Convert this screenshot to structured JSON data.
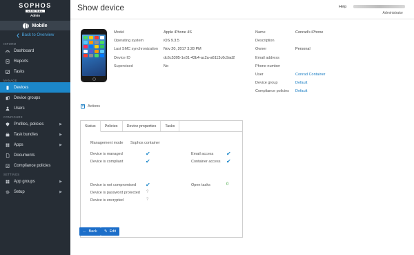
{
  "brand": {
    "name": "SOPHOS",
    "sub": "CENTRAL",
    "role": "Admin"
  },
  "module": {
    "label": "Mobile",
    "back_label": "Back to Overview"
  },
  "sidebar": {
    "sections": [
      {
        "label": "INFORM",
        "items": [
          {
            "label": "Dashboard",
            "icon": "dashboard-icon"
          },
          {
            "label": "Reports",
            "icon": "reports-icon"
          },
          {
            "label": "Tasks",
            "icon": "tasks-icon"
          }
        ]
      },
      {
        "label": "MANAGE",
        "items": [
          {
            "label": "Devices",
            "icon": "devices-icon",
            "active": true
          },
          {
            "label": "Device groups",
            "icon": "device-groups-icon"
          },
          {
            "label": "Users",
            "icon": "users-icon"
          }
        ]
      },
      {
        "label": "CONFIGURE",
        "items": [
          {
            "label": "Profiles, policies",
            "icon": "profiles-icon",
            "expand": true
          },
          {
            "label": "Task bundles",
            "icon": "task-bundles-icon",
            "expand": true
          },
          {
            "label": "Apps",
            "icon": "apps-icon",
            "expand": true
          },
          {
            "label": "Documents",
            "icon": "documents-icon"
          },
          {
            "label": "Compliance policies",
            "icon": "compliance-icon"
          }
        ]
      },
      {
        "label": "SETTINGS",
        "items": [
          {
            "label": "App groups",
            "icon": "app-groups-icon",
            "expand": true
          },
          {
            "label": "Setup",
            "icon": "setup-icon",
            "expand": true
          }
        ]
      }
    ]
  },
  "header": {
    "title": "Show device",
    "help": "Help",
    "role": "Administrator"
  },
  "device": {
    "left_labels": [
      "Model",
      "Operating system",
      "Last SMC synchronization",
      "Device ID",
      "Supervised"
    ],
    "left_values": [
      "Apple iPhone 4S",
      "iOS 9.3.5",
      "Nov 20, 2017 3:28 PM",
      "dc6c5305-1e31-43b4-ac2a-a6113c6c9ad2",
      "No"
    ],
    "right_labels": [
      "Name",
      "Description",
      "Owner",
      "Email address",
      "Phone number",
      "User",
      "Device group",
      "Compliance policies"
    ],
    "right_values": [
      "Conrad's iPhone",
      "",
      "Personal",
      "",
      "",
      "Conrad Container",
      "Default",
      "Default"
    ]
  },
  "actions_label": "Actions",
  "tabs": [
    "Status",
    "Policies",
    "Device properties",
    "Tasks"
  ],
  "status": {
    "management_mode_label": "Management mode",
    "management_mode_value": "Sophos container",
    "device_is_managed": "Device is managed",
    "device_is_compliant": "Device is compliant",
    "email_access": "Email access",
    "container_access": "Container access",
    "not_compromised": "Device is not compromised",
    "password_protected": "Device is password protected",
    "encrypted": "Device is encrypted",
    "open_tasks": "Open tasks",
    "open_tasks_count": "0"
  },
  "buttons": {
    "back": "Back",
    "edit": "Edit"
  },
  "colors": {
    "sidebar_bg": "#262d35",
    "accent": "#1c87c9",
    "button": "#1c6ec9"
  }
}
